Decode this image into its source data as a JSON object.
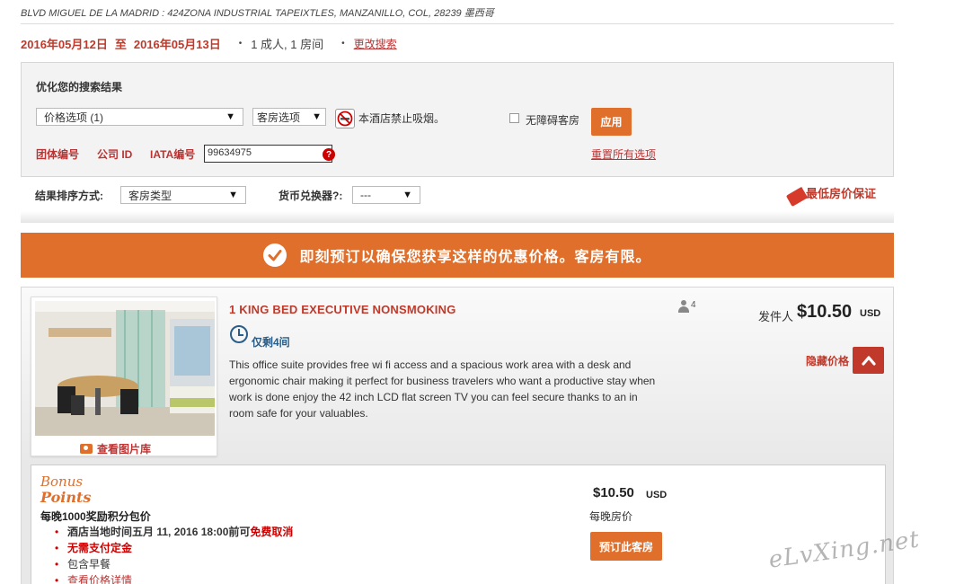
{
  "header": {
    "address": "BLVD MIGUEL DE LA MADRID : 424ZONA INDUSTRIAL TAPEIXTLES, MANZANILLO, COL, 28239  墨西哥",
    "checkin": "2016年05月12日",
    "to": "至",
    "checkout": "2016年05月13日",
    "guests": "1  成人, 1  房间",
    "change_search": "更改搜索"
  },
  "refine": {
    "title": "优化您的搜索结果",
    "price_option": "价格选项 (1)",
    "room_option": "客房选项",
    "no_smoking": "本酒店禁止吸烟。",
    "accessible": "无障碍客房",
    "apply": "应用",
    "group_code": "团体编号",
    "corporate_id": "公司 ID",
    "iata_label": "IATA编号",
    "iata_value": "99634975",
    "help": "?",
    "reset": "重置所有选项"
  },
  "sort": {
    "label": "结果排序方式:",
    "value": "客房类型",
    "fx_label": "货币兑换器?:",
    "fx_value": "---",
    "guarantee": "最低房价保证"
  },
  "banner": {
    "text": "即刻预订以确保您获享这样的优惠价格。客房有限。"
  },
  "room": {
    "title": "1 KING BED EXECUTIVE NONSMOKING",
    "rooms_left": "仅剩4间",
    "description": "This office suite provides free wi fi access and a spacious work area with a desk and ergonomic chair making it perfect for business travelers who want a productive stay when work is done enjoy the 42 inch LCD flat screen TV you can feel secure thanks to an in room safe for your valuables.",
    "occupancy": "4",
    "gallery": "查看图片库",
    "from_label": "发件人",
    "from_price": "$10.50",
    "currency": "USD",
    "hide_price": "隐藏价格"
  },
  "rate": {
    "bonus_line1": "Bonus",
    "bonus_line2": "Points",
    "package": "每晚1000奖励积分包价",
    "cancel_prefix": "酒店当地时间五月 11, 2016 18:00前可",
    "cancel_free": "免费取消",
    "no_deposit": "无需支付定金",
    "breakfast": "包含早餐",
    "details": "查看价格详情",
    "price": "$10.50",
    "currency": "USD",
    "per_night": "每晚房价",
    "book": "预订此客房"
  },
  "watermark": "eLvXing.net",
  "colors": {
    "accent_orange": "#e06f2c",
    "accent_red": "#c0392b",
    "link_blue": "#2a5d87"
  }
}
